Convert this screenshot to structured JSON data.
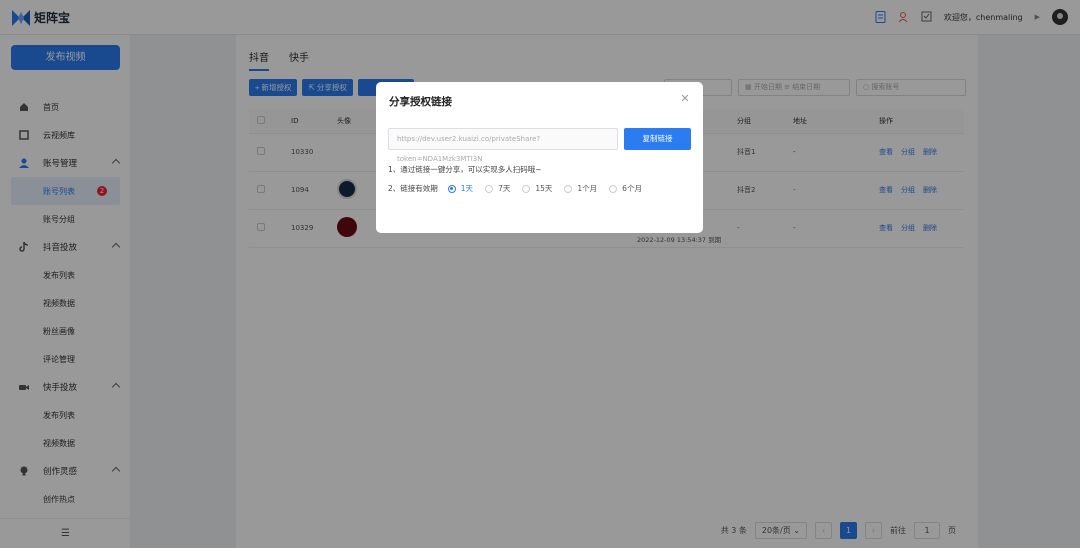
{
  "app": {
    "name": "矩阵宝"
  },
  "header": {
    "welcome": "欢迎您，chenmaling"
  },
  "sidebar": {
    "publish_label": "发布视频",
    "items": [
      {
        "label": "首页",
        "type": "item"
      },
      {
        "label": "云视频库",
        "type": "item"
      },
      {
        "label": "账号管理",
        "type": "group"
      },
      {
        "label": "账号列表",
        "type": "sub-active",
        "badge": "2"
      },
      {
        "label": "账号分组",
        "type": "sub"
      },
      {
        "label": "抖音投放",
        "type": "group"
      },
      {
        "label": "发布列表",
        "type": "sub"
      },
      {
        "label": "视频数据",
        "type": "sub"
      },
      {
        "label": "粉丝画像",
        "type": "sub"
      },
      {
        "label": "评论管理",
        "type": "sub"
      },
      {
        "label": "快手投放",
        "type": "group"
      },
      {
        "label": "发布列表",
        "type": "sub"
      },
      {
        "label": "视频数据",
        "type": "sub"
      },
      {
        "label": "创作灵感",
        "type": "group"
      },
      {
        "label": "创作热点",
        "type": "sub"
      }
    ],
    "collapse_icon": "☰"
  },
  "main": {
    "tabs": [
      "抖音",
      "快手"
    ],
    "toolbar": {
      "add": "新增授权",
      "share": "分享授权"
    },
    "filters": {
      "start_date": "开始日期",
      "end_date": "结束日期",
      "search_placeholder": "搜索账号"
    },
    "table": {
      "headers": [
        "ID",
        "头像",
        "分组",
        "地址",
        "操作"
      ],
      "rows": [
        {
          "id": "10330",
          "group": "抖音1",
          "address": "-"
        },
        {
          "id": "1094",
          "group": "抖音2",
          "address": "-"
        },
        {
          "id": "10329",
          "group": "-",
          "address": "-",
          "expire": "2022-12-09 13:54:37 到期"
        }
      ],
      "ops": [
        "查看",
        "分组",
        "删除"
      ]
    },
    "pager": {
      "total": "共 3 条",
      "page_size": "20条/页",
      "current": "1",
      "goto_label": "前往",
      "goto_value": "1",
      "page_unit": "页"
    }
  },
  "modal": {
    "title": "分享授权链接",
    "url": "https://dev.user2.kuaizi.co/privateShare?token=NDA1Mzk3MTI3N",
    "copy_label": "复制链接",
    "tip1": "1、通过链接一键分享，可以实现多人扫码哦~",
    "tip2_label": "2、链接有效期",
    "options": [
      "1天",
      "7天",
      "15天",
      "1个月",
      "6个月"
    ],
    "selected": "1天"
  },
  "colors": {
    "primary": "#2a7cf0",
    "badge": "#f5222d"
  }
}
